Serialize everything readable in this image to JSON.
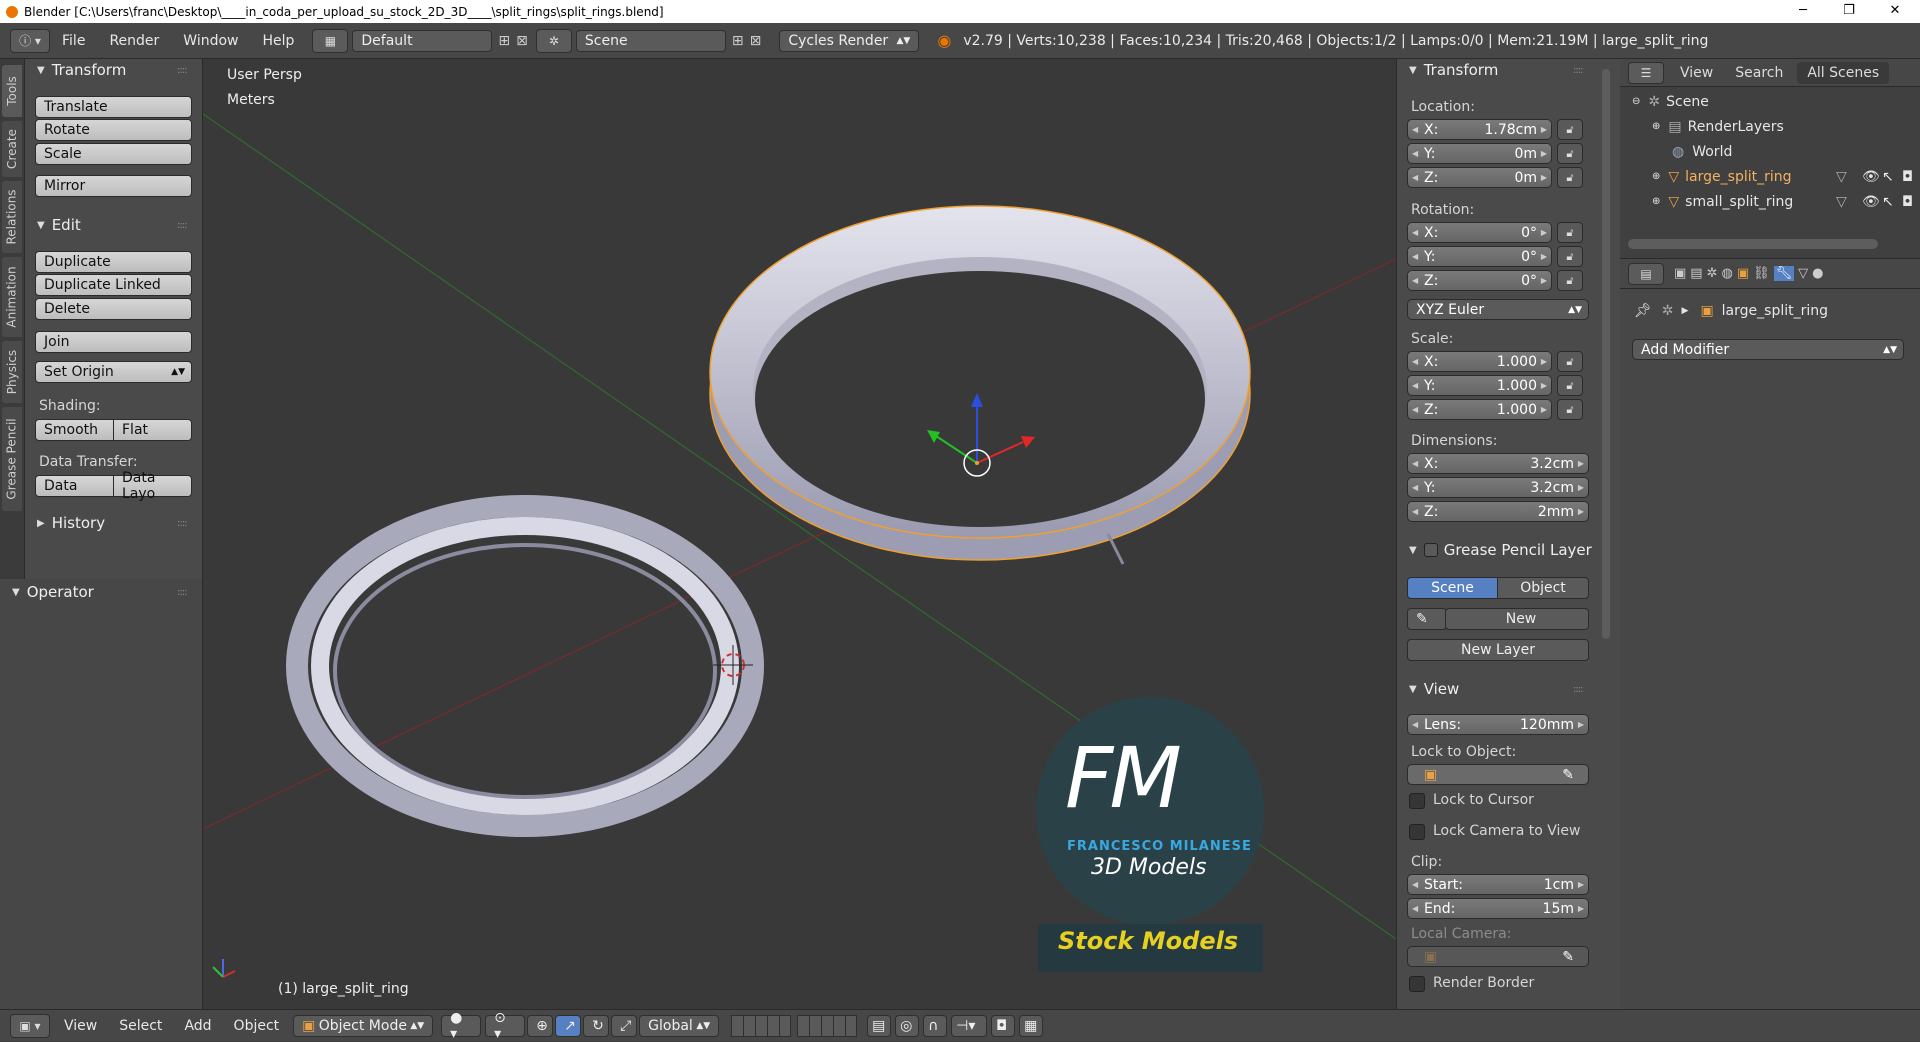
{
  "window": {
    "title": "Blender [C:\\Users\\franc\\Desktop\\____in_coda_per_upload_su_stock_2D_3D____\\split_rings\\split_rings.blend]",
    "minimize": "─",
    "maximize": "❐",
    "close": "✕"
  },
  "topbar": {
    "menus": [
      "File",
      "Render",
      "Window",
      "Help"
    ],
    "layout": "Default",
    "scene": "Scene",
    "engine": "Cycles Render",
    "stats": "v2.79 | Verts:10,238 | Faces:10,234 | Tris:20,468 | Objects:1/2 | Lamps:0/0 | Mem:21.19M | large_split_ring"
  },
  "tool_tabs": [
    "Tools",
    "Create",
    "Relations",
    "Animation",
    "Physics",
    "Grease Pencil"
  ],
  "toolshelf": {
    "transform_title": "Transform",
    "translate": "Translate",
    "rotate": "Rotate",
    "scale": "Scale",
    "mirror": "Mirror",
    "edit_title": "Edit",
    "duplicate": "Duplicate",
    "duplicate_linked": "Duplicate Linked",
    "delete": "Delete",
    "join": "Join",
    "set_origin": "Set Origin",
    "shading_label": "Shading:",
    "smooth": "Smooth",
    "flat": "Flat",
    "data_transfer_label": "Data Transfer:",
    "data": "Data",
    "data_layout": "Data Layo",
    "history_title": "History",
    "operator_title": "Operator"
  },
  "viewport": {
    "view_name": "User Persp",
    "units": "Meters",
    "active_object": "(1) large_split_ring",
    "watermark": {
      "monogram": "FM",
      "author": "FRANCESCO MILANESE",
      "subtitle": "3D Models",
      "banner": "Stock Models"
    }
  },
  "npanel": {
    "transform_title": "Transform",
    "location_label": "Location:",
    "location": [
      {
        "axis": "X:",
        "value": "1.78cm"
      },
      {
        "axis": "Y:",
        "value": "0m"
      },
      {
        "axis": "Z:",
        "value": "0m"
      }
    ],
    "rotation_label": "Rotation:",
    "rotation": [
      {
        "axis": "X:",
        "value": "0°"
      },
      {
        "axis": "Y:",
        "value": "0°"
      },
      {
        "axis": "Z:",
        "value": "0°"
      }
    ],
    "rotation_mode": "XYZ Euler",
    "scale_label": "Scale:",
    "scale": [
      {
        "axis": "X:",
        "value": "1.000"
      },
      {
        "axis": "Y:",
        "value": "1.000"
      },
      {
        "axis": "Z:",
        "value": "1.000"
      }
    ],
    "dimensions_label": "Dimensions:",
    "dimensions": [
      {
        "axis": "X:",
        "value": "3.2cm"
      },
      {
        "axis": "Y:",
        "value": "3.2cm"
      },
      {
        "axis": "Z:",
        "value": "2mm"
      }
    ],
    "grease_pencil_title": "Grease Pencil Layer",
    "scene_btn": "Scene",
    "object_btn": "Object",
    "new_btn": "New",
    "new_layer_btn": "New Layer",
    "view_title": "View",
    "lens_label": "Lens:",
    "lens_value": "120mm",
    "lock_to_object_label": "Lock to Object:",
    "lock_to_cursor": "Lock to Cursor",
    "lock_camera_to_view": "Lock Camera to View",
    "clip_label": "Clip:",
    "clip_start_label": "Start:",
    "clip_start_value": "1cm",
    "clip_end_label": "End:",
    "clip_end_value": "15m",
    "local_camera_label": "Local Camera:",
    "render_border": "Render Border"
  },
  "outliner": {
    "view": "View",
    "search": "Search",
    "scope": "All Scenes",
    "items": [
      "Scene",
      "RenderLayers",
      "World",
      "large_split_ring",
      "small_split_ring"
    ]
  },
  "properties": {
    "object_name": "large_split_ring",
    "add_modifier": "Add Modifier"
  },
  "bottombar": {
    "view": "View",
    "select": "Select",
    "add": "Add",
    "object": "Object",
    "mode": "Object Mode",
    "orientation": "Global"
  },
  "colors": {
    "accent_blue": "#5680c2",
    "selection_orange": "#f0a030",
    "banner_yellow": "#e8d020",
    "fm_blue": "#3aa8e0"
  }
}
